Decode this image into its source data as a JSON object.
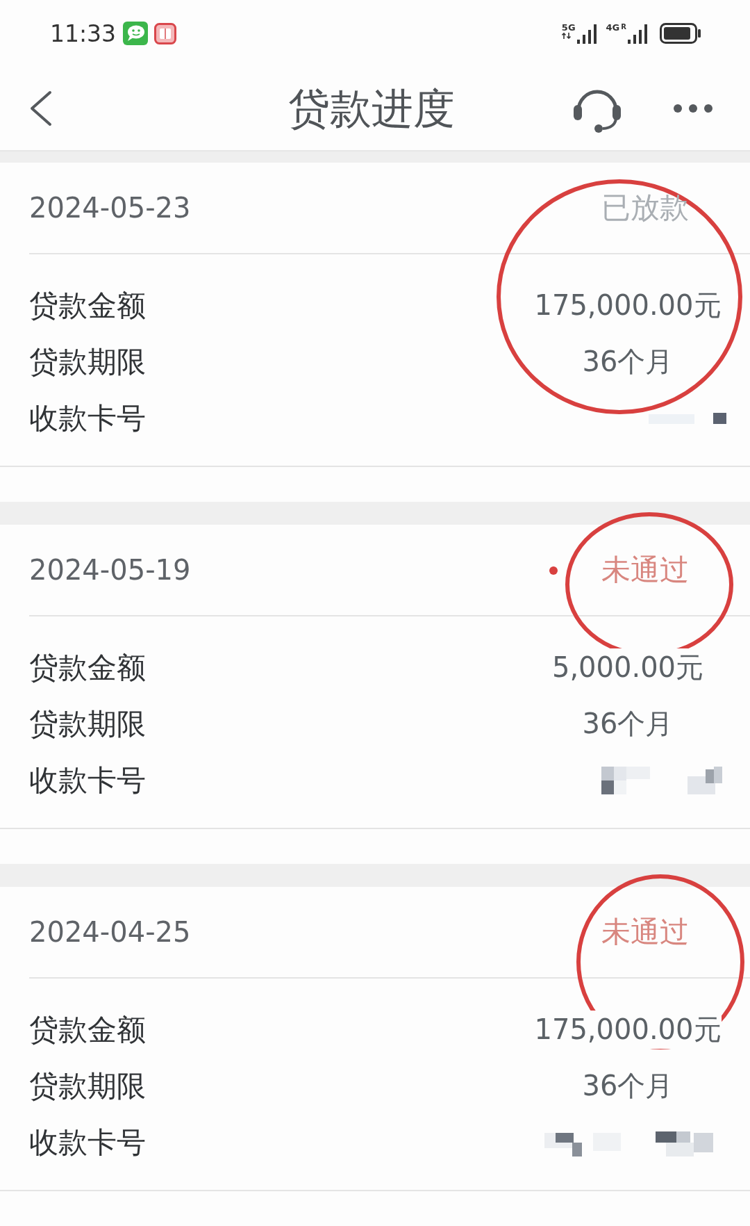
{
  "status_bar": {
    "time": "11:33",
    "signals": [
      {
        "label": "5G",
        "data_activity": true
      },
      {
        "label": "4G",
        "roaming": "R",
        "data_activity": false
      }
    ]
  },
  "header": {
    "title": "贷款进度"
  },
  "cards": [
    {
      "date": "2024-05-23",
      "status": {
        "text": "已放款",
        "kind": "disbursed"
      },
      "circled": true,
      "rows": [
        {
          "label": "贷款金额",
          "kind": "text",
          "value": "175,000.00元"
        },
        {
          "label": "贷款期限",
          "kind": "text",
          "value": "36个月"
        },
        {
          "label": "收款卡号",
          "kind": "masked"
        }
      ]
    },
    {
      "date": "2024-05-19",
      "status": {
        "text": "未通过",
        "kind": "rejected"
      },
      "circled": true,
      "rows": [
        {
          "label": "贷款金额",
          "kind": "text",
          "value": "5,000.00元"
        },
        {
          "label": "贷款期限",
          "kind": "text",
          "value": "36个月"
        },
        {
          "label": "收款卡号",
          "kind": "masked"
        }
      ]
    },
    {
      "date": "2024-04-25",
      "status": {
        "text": "未通过",
        "kind": "rejected"
      },
      "circled": true,
      "rows": [
        {
          "label": "贷款金额",
          "kind": "text",
          "value": "175,000.00元"
        },
        {
          "label": "贷款期限",
          "kind": "text",
          "value": "36个月"
        },
        {
          "label": "收款卡号",
          "kind": "masked"
        }
      ]
    }
  ]
}
